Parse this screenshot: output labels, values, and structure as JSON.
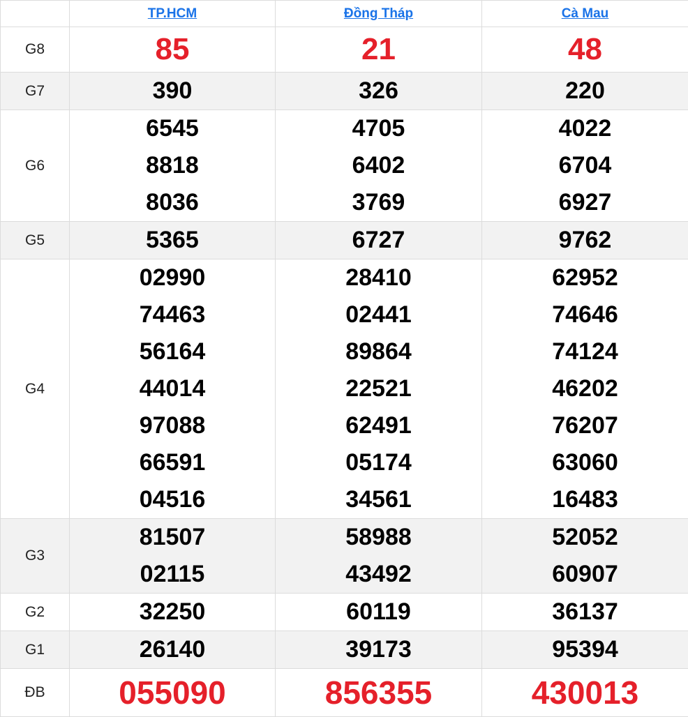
{
  "colors": {
    "header_link": "#1a73e8",
    "highlight": "#e5202a",
    "alt_row_bg": "#f2f2f2",
    "border": "#dcdcdc"
  },
  "provinces": [
    "TP.HCM",
    "Đồng Tháp",
    "Cà Mau"
  ],
  "prizes": [
    {
      "label": "G8",
      "highlight": true,
      "results": [
        [
          "85"
        ],
        [
          "21"
        ],
        [
          "48"
        ]
      ]
    },
    {
      "label": "G7",
      "results": [
        [
          "390"
        ],
        [
          "326"
        ],
        [
          "220"
        ]
      ]
    },
    {
      "label": "G6",
      "results": [
        [
          "6545",
          "8818",
          "8036"
        ],
        [
          "4705",
          "6402",
          "3769"
        ],
        [
          "4022",
          "6704",
          "6927"
        ]
      ]
    },
    {
      "label": "G5",
      "results": [
        [
          "5365"
        ],
        [
          "6727"
        ],
        [
          "9762"
        ]
      ]
    },
    {
      "label": "G4",
      "results": [
        [
          "02990",
          "74463",
          "56164",
          "44014",
          "97088",
          "66591",
          "04516"
        ],
        [
          "28410",
          "02441",
          "89864",
          "22521",
          "62491",
          "05174",
          "34561"
        ],
        [
          "62952",
          "74646",
          "74124",
          "46202",
          "76207",
          "63060",
          "16483"
        ]
      ]
    },
    {
      "label": "G3",
      "results": [
        [
          "81507",
          "02115"
        ],
        [
          "58988",
          "43492"
        ],
        [
          "52052",
          "60907"
        ]
      ]
    },
    {
      "label": "G2",
      "results": [
        [
          "32250"
        ],
        [
          "60119"
        ],
        [
          "36137"
        ]
      ]
    },
    {
      "label": "G1",
      "results": [
        [
          "26140"
        ],
        [
          "39173"
        ],
        [
          "95394"
        ]
      ]
    },
    {
      "label": "ĐB",
      "highlight": true,
      "results": [
        [
          "055090"
        ],
        [
          "856355"
        ],
        [
          "430013"
        ]
      ]
    }
  ]
}
